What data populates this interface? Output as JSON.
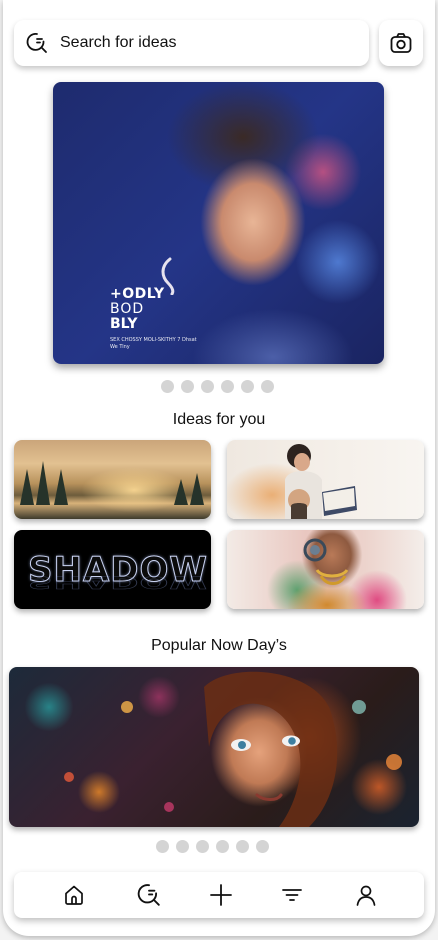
{
  "search": {
    "placeholder": "Search for ideas"
  },
  "hero": {
    "line1": "+ODLY",
    "line2": "BOD",
    "line3": "BLY",
    "line4": "SEX CHOSSY MOLI-SKITHY 7 Dhsat",
    "line5": "We Tiny"
  },
  "hero_carousel": {
    "page_count": 6
  },
  "ideas": {
    "title": "Ideas for you",
    "shadow_tile_text": "SHADOW"
  },
  "popular": {
    "title": "Popular Now Day’s"
  },
  "popular_carousel": {
    "page_count": 6
  },
  "nav": {
    "items": [
      "home-icon",
      "search-icon",
      "plus-icon",
      "filter-icon",
      "profile-icon"
    ]
  },
  "colors": {
    "dot": "#d4d4d4",
    "background": "#ffffff"
  }
}
